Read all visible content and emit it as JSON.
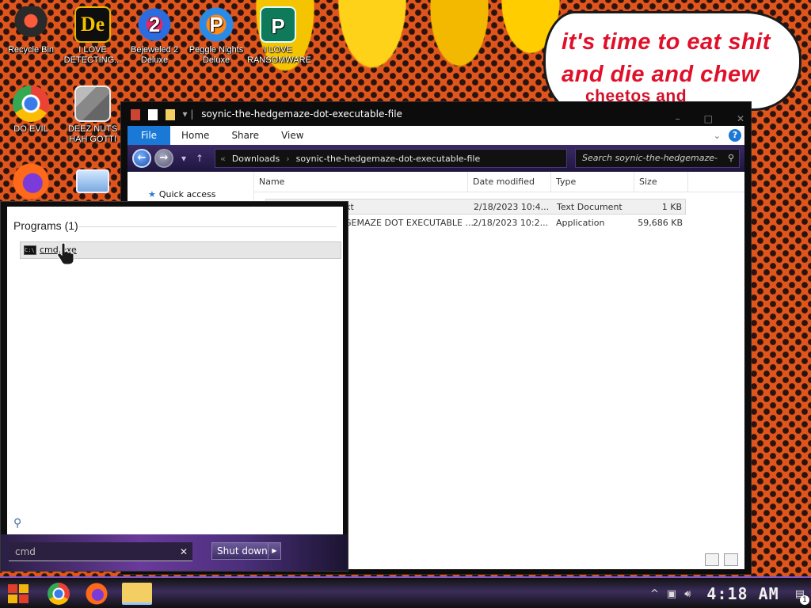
{
  "wallpaper": {
    "speech_line1": "it's time to eat shit",
    "speech_line2": "and die and chew",
    "speech_line3": "cheetos and"
  },
  "desktop_icons": [
    {
      "label": "Recycle Bin",
      "icon": "recycle-bin-icon"
    },
    {
      "label": "I LOVE DETECTING...",
      "icon": "detective-game-icon"
    },
    {
      "label": "Bejeweled 2 Deluxe",
      "icon": "bejeweled-icon"
    },
    {
      "label": "Peggle Nights Deluxe",
      "icon": "peggle-icon"
    },
    {
      "label": "I LOVE RANSOMWARE",
      "icon": "publisher-icon"
    },
    {
      "label": "DO EVIL",
      "icon": "chrome-icon"
    },
    {
      "label": "DEEZ NUTS HAH GOTTI",
      "icon": "folders-icon"
    },
    {
      "label": "",
      "icon": "firefox-icon"
    },
    {
      "label": "",
      "icon": "network-icon"
    }
  ],
  "explorer": {
    "title": "soynic-the-hedgemaze-dot-executable-file",
    "tabs": [
      "File",
      "Home",
      "Share",
      "View"
    ],
    "help_label": "?",
    "breadcrumb": [
      "Downloads",
      "soynic-the-hedgemaze-dot-executable-file"
    ],
    "search_placeholder": "Search soynic-the-hedgemaze-d...",
    "nav": {
      "quick_access": "Quick access"
    },
    "columns": [
      "Name",
      "Date modified",
      "Type",
      "Size"
    ],
    "files": [
      {
        "name": "xt",
        "date": "2/18/2023 10:4...",
        "type": "Text Document",
        "size": "1 KB"
      },
      {
        "name": "GEMAZE DOT EXECUTABLE ...",
        "date": "2/18/2023 10:2...",
        "type": "Application",
        "size": "59,686 KB"
      }
    ]
  },
  "start_menu": {
    "group_label": "Programs (1)",
    "result": "cmd.exe",
    "search_value": "cmd",
    "shutdown_label": "Shut down"
  },
  "taskbar": {
    "clock": "4:18 AM",
    "notification_count": "1"
  },
  "colors": {
    "accent_purple": "#7f57c9",
    "file_tab_blue": "#1a78d7",
    "speech_red": "#e0102a"
  }
}
